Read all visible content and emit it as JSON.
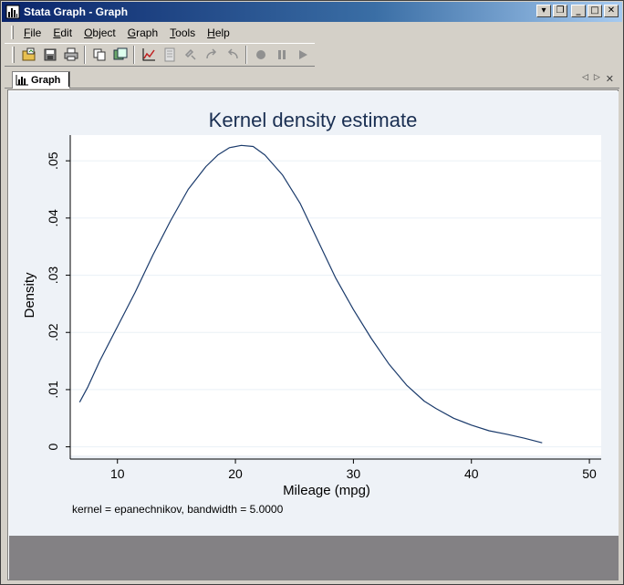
{
  "window": {
    "title": "Stata Graph - Graph",
    "controls": [
      "minimize-doc",
      "restore-doc",
      "minimize",
      "maximize",
      "close"
    ]
  },
  "menu": {
    "items": [
      {
        "label": "File",
        "underline": "F",
        "rest": "ile"
      },
      {
        "label": "Edit",
        "underline": "E",
        "rest": "dit"
      },
      {
        "label": "Object",
        "underline": "O",
        "rest": "bject"
      },
      {
        "label": "Graph",
        "underline": "G",
        "rest": "raph"
      },
      {
        "label": "Tools",
        "underline": "T",
        "rest": "ools"
      },
      {
        "label": "Help",
        "underline": "H",
        "rest": "elp"
      }
    ]
  },
  "toolbar": {
    "buttons": [
      "open-graph-icon",
      "save-icon",
      "print-icon",
      "copy-icon",
      "rename-icon",
      "graph-editor-icon",
      "recorder-icon",
      "pointer-tool-icon",
      "undo-icon",
      "redo-icon",
      "record-icon",
      "pause-icon",
      "play-icon"
    ]
  },
  "tab": {
    "label": "Graph"
  },
  "chart_data": {
    "type": "line",
    "title": "Kernel density estimate",
    "xlabel": "Mileage (mpg)",
    "ylabel": "Density",
    "xlim": [
      6,
      51
    ],
    "ylim": [
      -0.0015,
      0.0545
    ],
    "xticks": [
      10,
      20,
      30,
      40,
      50
    ],
    "yticks": [
      0,
      0.01,
      0.02,
      0.03,
      0.04,
      0.05
    ],
    "ytick_labels": [
      "0",
      ".01",
      ".02",
      ".03",
      ".04",
      ".05"
    ],
    "grid": true,
    "line_color": "#1a3a6b",
    "note": "kernel = epanechnikov, bandwidth = 5.0000",
    "series": [
      {
        "x": [
          6.8,
          7.5,
          8.5,
          10,
          11.5,
          13,
          14.5,
          16,
          17.5,
          18.5,
          19.5,
          20.5,
          21.5,
          22.5,
          24,
          25.5,
          27,
          28.5,
          30,
          31.5,
          33,
          34.5,
          36,
          37,
          38.5,
          40,
          41.5,
          43,
          44.5,
          46
        ],
        "y": [
          0.0078,
          0.0105,
          0.015,
          0.021,
          0.027,
          0.0335,
          0.0395,
          0.045,
          0.049,
          0.051,
          0.0523,
          0.0527,
          0.0525,
          0.051,
          0.0475,
          0.0425,
          0.036,
          0.0295,
          0.024,
          0.019,
          0.0145,
          0.0108,
          0.008,
          0.0067,
          0.005,
          0.0038,
          0.0028,
          0.0022,
          0.0015,
          0.0007
        ]
      }
    ]
  }
}
